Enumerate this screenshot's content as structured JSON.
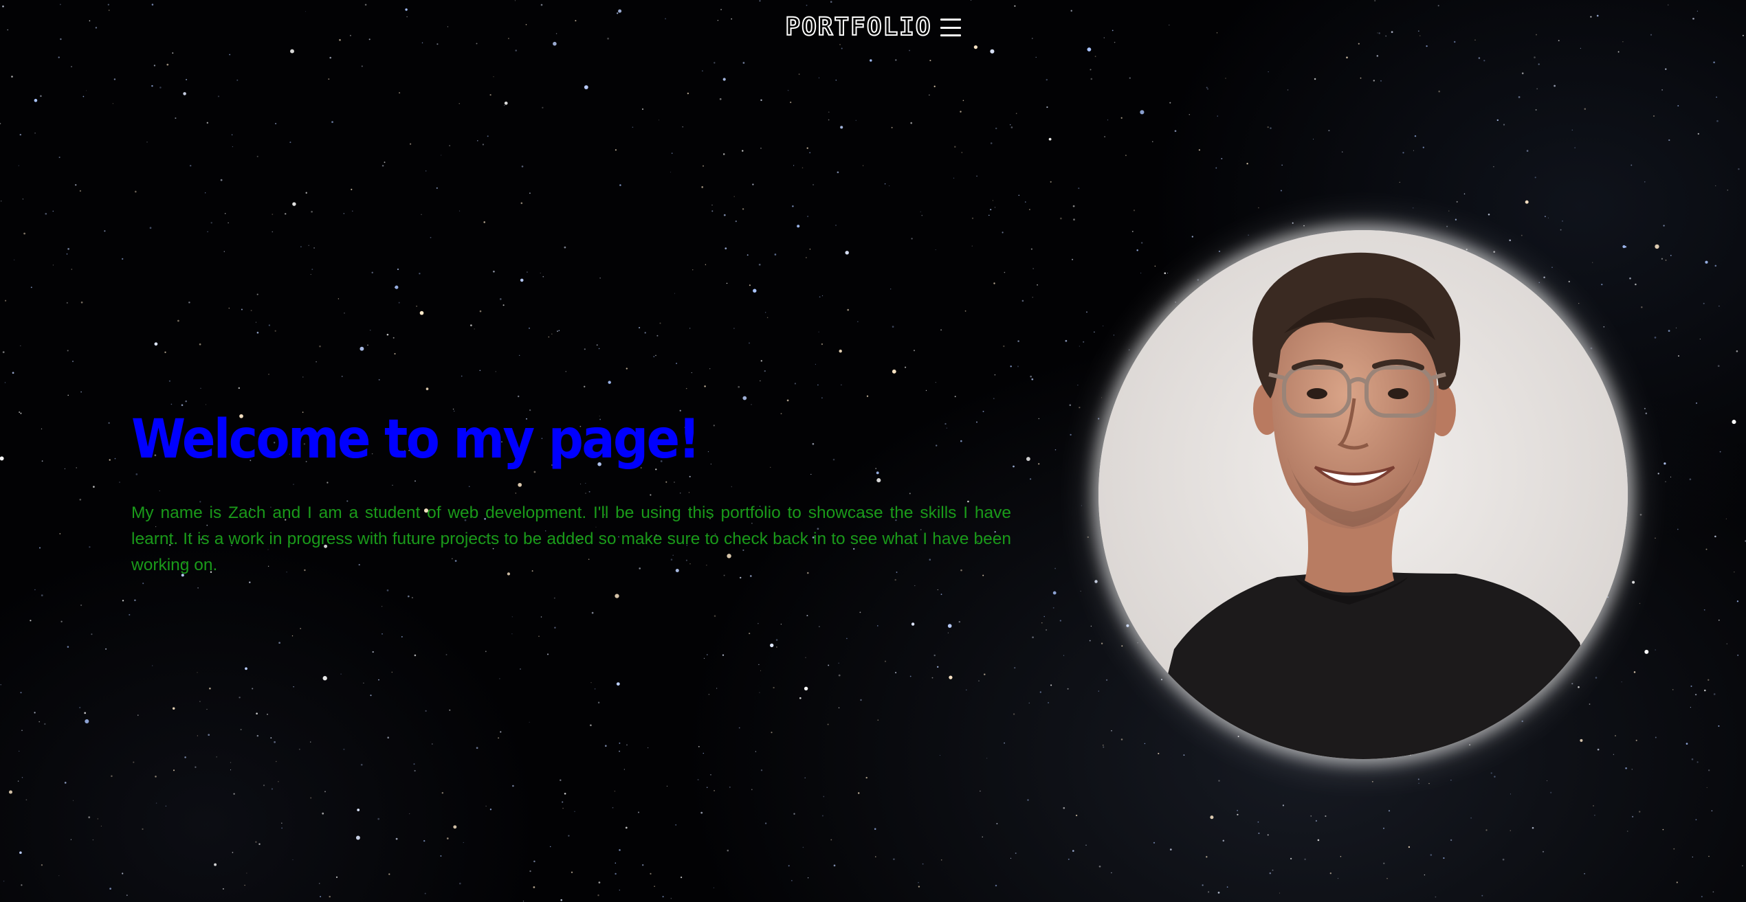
{
  "header": {
    "logo_text": "PORTFOLIO",
    "menu_icon": "hamburger-menu-icon"
  },
  "hero": {
    "title": "Welcome to my page!",
    "description": "My name is Zach and I am a student of web development. I'll be using this portfolio to showcase the skills I have learnt. It is a work in progress with future projects to be added so make sure to check back in to see what I have been working on."
  },
  "colors": {
    "background": "#000000",
    "title": "#0000ff",
    "description": "#1a9a1a",
    "logo": "#ffffff",
    "portrait_glow": "#ffffff"
  }
}
